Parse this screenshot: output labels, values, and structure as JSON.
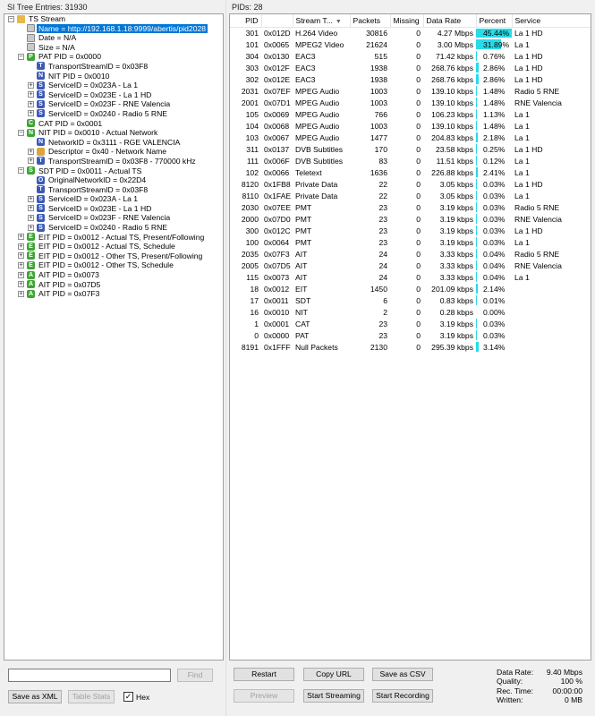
{
  "left": {
    "header": "SI Tree Entries: 31930",
    "tree": [
      {
        "level": 0,
        "exp": "−",
        "icon": "folder",
        "letter": "",
        "text": "TS Stream"
      },
      {
        "level": 1,
        "exp": "",
        "icon": "doc",
        "letter": "",
        "text": "Name = http://192.168.1.18:9999/abertis/pid2028",
        "selected": true
      },
      {
        "level": 1,
        "exp": "",
        "icon": "doc",
        "letter": "",
        "text": "Date = N/A"
      },
      {
        "level": 1,
        "exp": "",
        "icon": "doc",
        "letter": "",
        "text": "Size = N/A"
      },
      {
        "level": 1,
        "exp": "−",
        "icon": "green",
        "letter": "P",
        "text": "PAT PID = 0x0000"
      },
      {
        "level": 2,
        "exp": "",
        "icon": "blue",
        "letter": "T",
        "text": "TransportStreamID = 0x03F8"
      },
      {
        "level": 2,
        "exp": "",
        "icon": "blue",
        "letter": "N",
        "text": "NIT PID = 0x0010"
      },
      {
        "level": 2,
        "exp": "+",
        "icon": "blue",
        "letter": "S",
        "text": "ServiceID = 0x023A - La 1"
      },
      {
        "level": 2,
        "exp": "+",
        "icon": "blue",
        "letter": "S",
        "text": "ServiceID = 0x023E - La 1 HD"
      },
      {
        "level": 2,
        "exp": "+",
        "icon": "blue",
        "letter": "S",
        "text": "ServiceID = 0x023F - RNE Valencia"
      },
      {
        "level": 2,
        "exp": "+",
        "icon": "blue",
        "letter": "S",
        "text": "ServiceID = 0x0240 - Radio 5 RNE"
      },
      {
        "level": 1,
        "exp": "",
        "icon": "green",
        "letter": "C",
        "text": "CAT PID = 0x0001"
      },
      {
        "level": 1,
        "exp": "−",
        "icon": "green",
        "letter": "N",
        "text": "NIT PID = 0x0010 - Actual Network"
      },
      {
        "level": 2,
        "exp": "",
        "icon": "blue",
        "letter": "N",
        "text": "NetworkID = 0x3111 - RGE VALENCIA"
      },
      {
        "level": 2,
        "exp": "+",
        "icon": "tan",
        "letter": "",
        "text": "Descriptor = 0x40 - Network Name"
      },
      {
        "level": 2,
        "exp": "+",
        "icon": "blue",
        "letter": "T",
        "text": "TransportStreamID = 0x03F8 - 770000 kHz"
      },
      {
        "level": 1,
        "exp": "−",
        "icon": "green",
        "letter": "S",
        "text": "SDT PID = 0x0011 - Actual TS"
      },
      {
        "level": 2,
        "exp": "",
        "icon": "blue",
        "letter": "O",
        "text": "OriginalNetworkID = 0x22D4"
      },
      {
        "level": 2,
        "exp": "",
        "icon": "blue",
        "letter": "T",
        "text": "TransportStreamID = 0x03F8"
      },
      {
        "level": 2,
        "exp": "+",
        "icon": "blue",
        "letter": "S",
        "text": "ServiceID = 0x023A - La 1"
      },
      {
        "level": 2,
        "exp": "+",
        "icon": "blue",
        "letter": "S",
        "text": "ServiceID = 0x023E - La 1 HD"
      },
      {
        "level": 2,
        "exp": "+",
        "icon": "blue",
        "letter": "S",
        "text": "ServiceID = 0x023F - RNE Valencia"
      },
      {
        "level": 2,
        "exp": "+",
        "icon": "blue",
        "letter": "S",
        "text": "ServiceID = 0x0240 - Radio 5 RNE"
      },
      {
        "level": 1,
        "exp": "+",
        "icon": "green",
        "letter": "E",
        "text": "EIT PID = 0x0012 - Actual TS, Present/Following"
      },
      {
        "level": 1,
        "exp": "+",
        "icon": "green",
        "letter": "E",
        "text": "EIT PID = 0x0012 - Actual TS, Schedule"
      },
      {
        "level": 1,
        "exp": "+",
        "icon": "green",
        "letter": "E",
        "text": "EIT PID = 0x0012 - Other TS, Present/Following"
      },
      {
        "level": 1,
        "exp": "+",
        "icon": "green",
        "letter": "E",
        "text": "EIT PID = 0x0012 - Other TS, Schedule"
      },
      {
        "level": 1,
        "exp": "+",
        "icon": "green",
        "letter": "A",
        "text": "AIT PID = 0x0073"
      },
      {
        "level": 1,
        "exp": "+",
        "icon": "green",
        "letter": "A",
        "text": "AIT PID = 0x07D5"
      },
      {
        "level": 1,
        "exp": "+",
        "icon": "green",
        "letter": "A",
        "text": "AIT PID = 0x07F3"
      }
    ],
    "find_placeholder": "",
    "find_label": "Find",
    "save_xml_label": "Save as XML",
    "table_stats_label": "Table Stats",
    "hex_label": "Hex",
    "hex_checked": "✓"
  },
  "right": {
    "header": "PIDs: 28",
    "columns": [
      "PID",
      "",
      "Stream T...",
      "Packets",
      "Missing",
      "Data Rate",
      "Percent",
      "Service"
    ],
    "rows": [
      {
        "pid": "301",
        "hex": "0x012D",
        "type": "H.264 Video",
        "packets": "30816",
        "missing": "0",
        "rate": "4.27 Mbps",
        "pct": 45.44,
        "pct_text": "45.44%",
        "service": "La 1 HD"
      },
      {
        "pid": "101",
        "hex": "0x0065",
        "type": "MPEG2 Video",
        "packets": "21624",
        "missing": "0",
        "rate": "3.00 Mbps",
        "pct": 31.89,
        "pct_text": "31.89%",
        "service": "La 1"
      },
      {
        "pid": "304",
        "hex": "0x0130",
        "type": "EAC3",
        "packets": "515",
        "missing": "0",
        "rate": "71.42 kbps",
        "pct": 0.76,
        "pct_text": "0.76%",
        "service": "La 1 HD"
      },
      {
        "pid": "303",
        "hex": "0x012F",
        "type": "EAC3",
        "packets": "1938",
        "missing": "0",
        "rate": "268.76 kbps",
        "pct": 2.86,
        "pct_text": "2.86%",
        "service": "La 1 HD"
      },
      {
        "pid": "302",
        "hex": "0x012E",
        "type": "EAC3",
        "packets": "1938",
        "missing": "0",
        "rate": "268.76 kbps",
        "pct": 2.86,
        "pct_text": "2.86%",
        "service": "La 1 HD"
      },
      {
        "pid": "2031",
        "hex": "0x07EF",
        "type": "MPEG Audio",
        "packets": "1003",
        "missing": "0",
        "rate": "139.10 kbps",
        "pct": 1.48,
        "pct_text": "1.48%",
        "service": "Radio 5 RNE"
      },
      {
        "pid": "2001",
        "hex": "0x07D1",
        "type": "MPEG Audio",
        "packets": "1003",
        "missing": "0",
        "rate": "139.10 kbps",
        "pct": 1.48,
        "pct_text": "1.48%",
        "service": "RNE Valencia"
      },
      {
        "pid": "105",
        "hex": "0x0069",
        "type": "MPEG Audio",
        "packets": "766",
        "missing": "0",
        "rate": "106.23 kbps",
        "pct": 1.13,
        "pct_text": "1.13%",
        "service": "La 1"
      },
      {
        "pid": "104",
        "hex": "0x0068",
        "type": "MPEG Audio",
        "packets": "1003",
        "missing": "0",
        "rate": "139.10 kbps",
        "pct": 1.48,
        "pct_text": "1.48%",
        "service": "La 1"
      },
      {
        "pid": "103",
        "hex": "0x0067",
        "type": "MPEG Audio",
        "packets": "1477",
        "missing": "0",
        "rate": "204.83 kbps",
        "pct": 2.18,
        "pct_text": "2.18%",
        "service": "La 1"
      },
      {
        "pid": "311",
        "hex": "0x0137",
        "type": "DVB Subtitles",
        "packets": "170",
        "missing": "0",
        "rate": "23.58 kbps",
        "pct": 0.25,
        "pct_text": "0.25%",
        "service": "La 1 HD"
      },
      {
        "pid": "111",
        "hex": "0x006F",
        "type": "DVB Subtitles",
        "packets": "83",
        "missing": "0",
        "rate": "11.51 kbps",
        "pct": 0.12,
        "pct_text": "0.12%",
        "service": "La 1"
      },
      {
        "pid": "102",
        "hex": "0x0066",
        "type": "Teletext",
        "packets": "1636",
        "missing": "0",
        "rate": "226.88 kbps",
        "pct": 2.41,
        "pct_text": "2.41%",
        "service": "La 1"
      },
      {
        "pid": "8120",
        "hex": "0x1FB8",
        "type": "Private Data",
        "packets": "22",
        "missing": "0",
        "rate": "3.05 kbps",
        "pct": 0.03,
        "pct_text": "0.03%",
        "service": "La 1 HD"
      },
      {
        "pid": "8110",
        "hex": "0x1FAE",
        "type": "Private Data",
        "packets": "22",
        "missing": "0",
        "rate": "3.05 kbps",
        "pct": 0.03,
        "pct_text": "0.03%",
        "service": "La 1"
      },
      {
        "pid": "2030",
        "hex": "0x07EE",
        "type": "PMT",
        "packets": "23",
        "missing": "0",
        "rate": "3.19 kbps",
        "pct": 0.03,
        "pct_text": "0.03%",
        "service": "Radio 5 RNE"
      },
      {
        "pid": "2000",
        "hex": "0x07D0",
        "type": "PMT",
        "packets": "23",
        "missing": "0",
        "rate": "3.19 kbps",
        "pct": 0.03,
        "pct_text": "0.03%",
        "service": "RNE Valencia"
      },
      {
        "pid": "300",
        "hex": "0x012C",
        "type": "PMT",
        "packets": "23",
        "missing": "0",
        "rate": "3.19 kbps",
        "pct": 0.03,
        "pct_text": "0.03%",
        "service": "La 1 HD"
      },
      {
        "pid": "100",
        "hex": "0x0064",
        "type": "PMT",
        "packets": "23",
        "missing": "0",
        "rate": "3.19 kbps",
        "pct": 0.03,
        "pct_text": "0.03%",
        "service": "La 1"
      },
      {
        "pid": "2035",
        "hex": "0x07F3",
        "type": "AIT",
        "packets": "24",
        "missing": "0",
        "rate": "3.33 kbps",
        "pct": 0.04,
        "pct_text": "0.04%",
        "service": "Radio 5 RNE"
      },
      {
        "pid": "2005",
        "hex": "0x07D5",
        "type": "AIT",
        "packets": "24",
        "missing": "0",
        "rate": "3.33 kbps",
        "pct": 0.04,
        "pct_text": "0.04%",
        "service": "RNE Valencia"
      },
      {
        "pid": "115",
        "hex": "0x0073",
        "type": "AIT",
        "packets": "24",
        "missing": "0",
        "rate": "3.33 kbps",
        "pct": 0.04,
        "pct_text": "0.04%",
        "service": "La 1"
      },
      {
        "pid": "18",
        "hex": "0x0012",
        "type": "EIT",
        "packets": "1450",
        "missing": "0",
        "rate": "201.09 kbps",
        "pct": 2.14,
        "pct_text": "2.14%",
        "service": ""
      },
      {
        "pid": "17",
        "hex": "0x0011",
        "type": "SDT",
        "packets": "6",
        "missing": "0",
        "rate": "0.83 kbps",
        "pct": 0.01,
        "pct_text": "0.01%",
        "service": ""
      },
      {
        "pid": "16",
        "hex": "0x0010",
        "type": "NIT",
        "packets": "2",
        "missing": "0",
        "rate": "0.28 kbps",
        "pct": 0.0,
        "pct_text": "0.00%",
        "service": ""
      },
      {
        "pid": "1",
        "hex": "0x0001",
        "type": "CAT",
        "packets": "23",
        "missing": "0",
        "rate": "3.19 kbps",
        "pct": 0.03,
        "pct_text": "0.03%",
        "service": ""
      },
      {
        "pid": "0",
        "hex": "0x0000",
        "type": "PAT",
        "packets": "23",
        "missing": "0",
        "rate": "3.19 kbps",
        "pct": 0.03,
        "pct_text": "0.03%",
        "service": ""
      },
      {
        "pid": "8191",
        "hex": "0x1FFF",
        "type": "Null Packets",
        "packets": "2130",
        "missing": "0",
        "rate": "295.39 kbps",
        "pct": 3.14,
        "pct_text": "3.14%",
        "service": ""
      }
    ],
    "buttons": {
      "restart": "Restart",
      "copy_url": "Copy URL",
      "save_csv": "Save as CSV",
      "preview": "Preview",
      "start_streaming": "Start Streaming",
      "start_recording": "Start Recording"
    },
    "stats": {
      "data_rate_label": "Data Rate:",
      "data_rate": "9.40 Mbps",
      "quality_label": "Quality:",
      "quality": "100 %",
      "rec_time_label": "Rec. Time:",
      "rec_time": "00:00:00",
      "written_label": "Written:",
      "written": "0 MB"
    },
    "bar_color": "#27dbe9"
  }
}
